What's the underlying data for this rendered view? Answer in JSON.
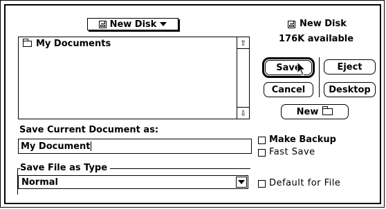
{
  "volume_popup": {
    "label": "New Disk"
  },
  "file_list": {
    "items": [
      {
        "label": "My Documents"
      }
    ]
  },
  "disk_info": {
    "name": "New Disk",
    "available": "176K available"
  },
  "buttons": {
    "save": "Save",
    "eject": "Eject",
    "cancel": "Cancel",
    "desktop": "Desktop",
    "new": "New"
  },
  "save_prompt": {
    "label": "Save Current Document as:",
    "value": "My Document"
  },
  "options": {
    "make_backup": "Make Backup",
    "fast_save": "Fast Save",
    "default_for_file": "Default for File"
  },
  "file_type": {
    "group_label": "Save File as Type",
    "selected": "Normal"
  },
  "pointer": {
    "over": "save-button"
  }
}
